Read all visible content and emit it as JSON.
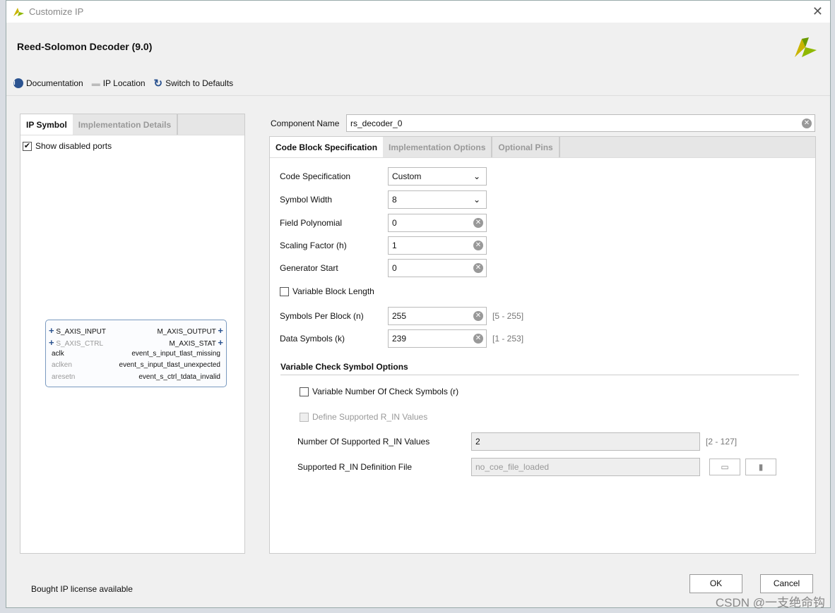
{
  "window": {
    "title": "Customize IP"
  },
  "header": {
    "title": "Reed-Solomon Decoder (9.0)"
  },
  "toolbar": {
    "documentation": "Documentation",
    "ip_location": "IP Location",
    "switch_defaults": "Switch to Defaults"
  },
  "left": {
    "tabs": [
      "IP Symbol",
      "Implementation Details"
    ],
    "show_disabled_ports": "Show disabled ports",
    "ports_left": [
      "S_AXIS_INPUT",
      "S_AXIS_CTRL",
      "aclk",
      "aclken",
      "aresetn"
    ],
    "ports_right": [
      "M_AXIS_OUTPUT",
      "M_AXIS_STAT",
      "event_s_input_tlast_missing",
      "event_s_input_tlast_unexpected",
      "event_s_ctrl_tdata_invalid"
    ]
  },
  "component": {
    "label": "Component Name",
    "value": "rs_decoder_0"
  },
  "right": {
    "tabs": [
      "Code Block Specification",
      "Implementation Options",
      "Optional Pins"
    ],
    "code_spec": {
      "label": "Code Specification",
      "value": "Custom"
    },
    "symbol_width": {
      "label": "Symbol Width",
      "value": "8"
    },
    "field_poly": {
      "label": "Field Polynomial",
      "value": "0"
    },
    "scaling": {
      "label": "Scaling Factor (h)",
      "value": "1"
    },
    "gen_start": {
      "label": "Generator Start",
      "value": "0"
    },
    "var_block": "Variable Block Length",
    "n": {
      "label": "Symbols Per Block (n)",
      "value": "255",
      "range": "[5 - 255]"
    },
    "k": {
      "label": "Data Symbols (k)",
      "value": "239",
      "range": "[1 - 253]"
    },
    "section": "Variable Check Symbol Options",
    "var_check": "Variable Number Of Check Symbols (r)",
    "define_rin": "Define Supported R_IN Values",
    "num_rin": {
      "label": "Number Of Supported R_IN Values",
      "value": "2",
      "range": "[2 - 127]"
    },
    "rin_file": {
      "label": "Supported R_IN Definition File",
      "value": "no_coe_file_loaded"
    }
  },
  "footer": {
    "license": "Bought IP license available",
    "ok": "OK",
    "cancel": "Cancel"
  },
  "watermark": "CSDN @一支绝命钩"
}
